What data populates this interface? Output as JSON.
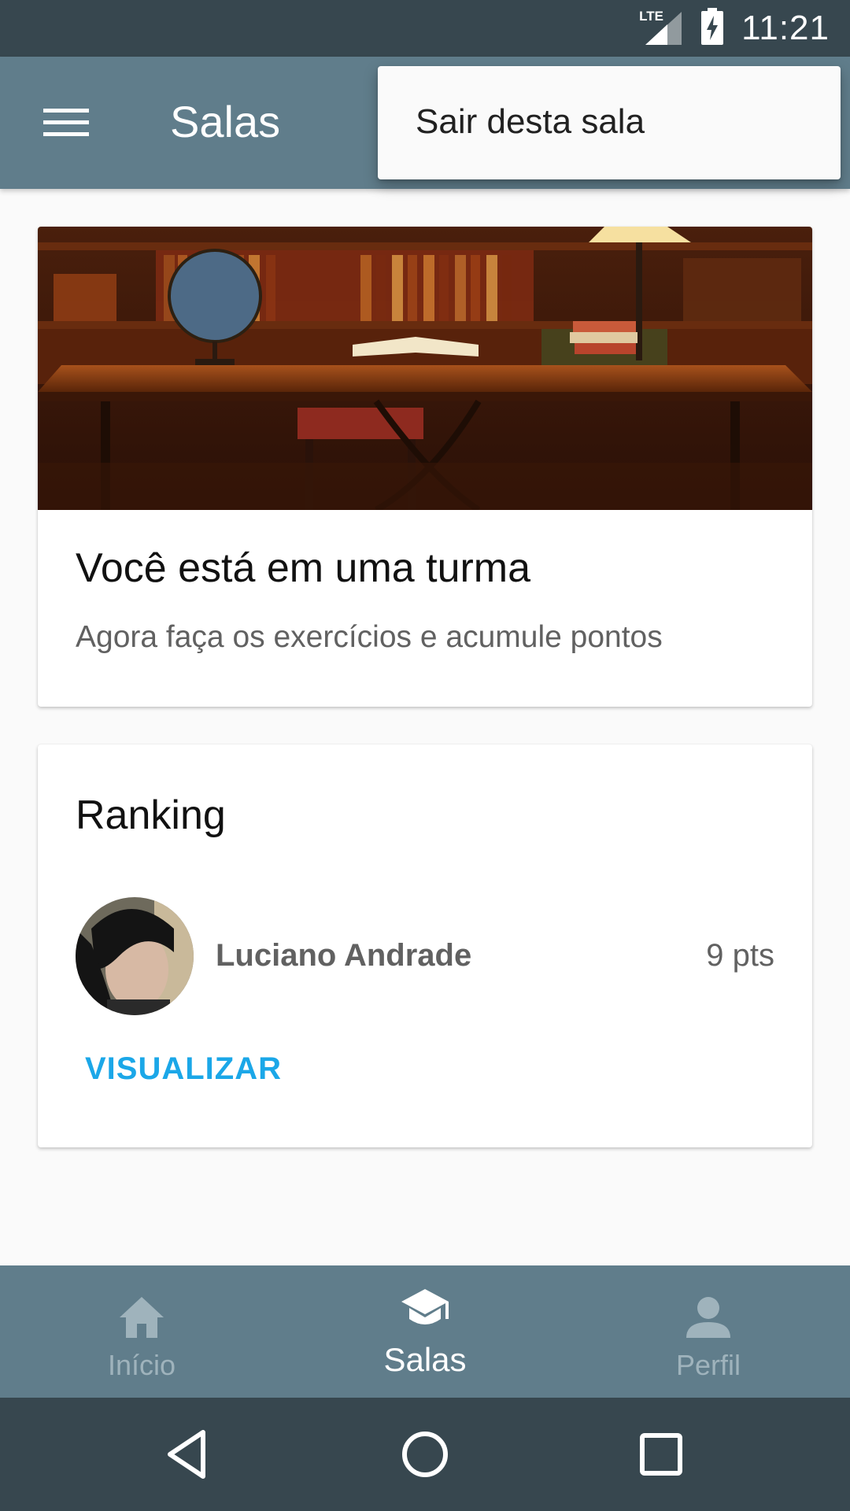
{
  "status_bar": {
    "network": "LTE",
    "time": "11:21"
  },
  "app_bar": {
    "title": "Salas",
    "menu_icon": "hamburger-menu-icon"
  },
  "popup_menu": {
    "items": [
      {
        "label": "Sair desta sala"
      }
    ]
  },
  "class_card": {
    "image": "library-desk-photo",
    "title": "Você está em uma turma",
    "subtitle": "Agora faça os exercícios e acumule pontos"
  },
  "ranking_card": {
    "title": "Ranking",
    "entries": [
      {
        "name": "Luciano Andrade",
        "points": "9 pts",
        "avatar": "user-avatar-photo"
      }
    ],
    "action_label": "VISUALIZAR",
    "action_color": "#1ba7e8"
  },
  "bottom_nav": {
    "items": [
      {
        "label": "Início",
        "icon": "home-icon",
        "active": false
      },
      {
        "label": "Salas",
        "icon": "school-icon",
        "active": true
      },
      {
        "label": "Perfil",
        "icon": "person-icon",
        "active": false
      }
    ]
  },
  "system_nav": {
    "back": "back-icon",
    "home": "home-circle-icon",
    "recents": "recents-icon"
  },
  "colors": {
    "primary": "#607d8b",
    "primary_dark": "#37474f",
    "accent": "#1ba7e8",
    "background": "#fafafa"
  }
}
